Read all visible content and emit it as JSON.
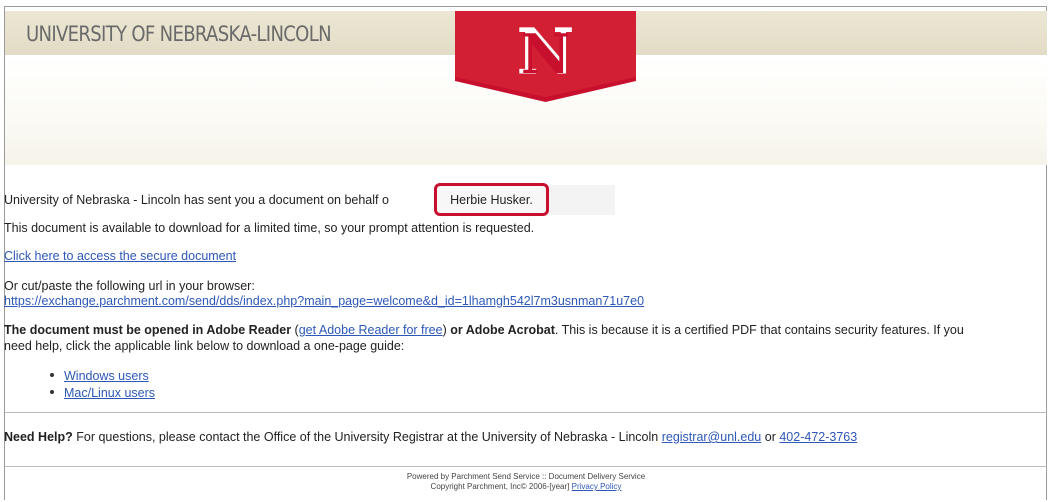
{
  "header": {
    "university_name": "UNIVERSITY OF NEBRASKA-LINCOLN",
    "logo_letter": "N",
    "brand_red": "#c8102e"
  },
  "message": {
    "sent_prefix": "University of Nebraska - Lincoln has sent you a document on behalf o",
    "sender_name": "Herbie Husker.",
    "availability": "This document is available to download for a limited time, so your prompt attention is requested.",
    "access_link": "Click here to access the secure document",
    "url_intro": "Or cut/paste the following url in your browser:",
    "url": "https://exchange.parchment.com/send/dds/index.php?main_page=welcome&d_id=1lhamgh542l7m3usnman71u7e0",
    "reader_bold": "The document must be opened in Adobe Reader",
    "reader_link": "get Adobe Reader for free",
    "or_acrobat_bold": "or Adobe Acrobat",
    "reader_rest": ". This is because it is a certified PDF that contains security features. If you",
    "help_guide_line": "need help, click the applicable link below to download a one-page guide:",
    "guides": [
      {
        "label": "Windows users"
      },
      {
        "label": "Mac/Linux users"
      }
    ]
  },
  "help": {
    "bold": "Need Help?",
    "text": "For questions, please contact the Office of the University Registrar at the University of Nebraska - Lincoln",
    "email": "registrar@unl.edu",
    "or": "or",
    "phone": "402-472-3763"
  },
  "footer": {
    "powered_by": "Powered by Parchment Send Service :: Document Delivery Service",
    "copyright": "Copyright Parchment, Inc© 2006-[year]",
    "privacy_link": "Privacy Policy"
  }
}
